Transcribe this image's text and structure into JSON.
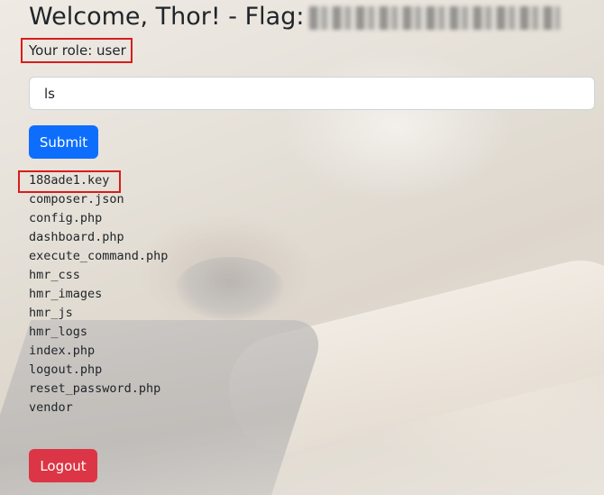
{
  "header": {
    "welcome_text": "Welcome, Thor! - Flag:",
    "flag_value": "THM{REDACTED}"
  },
  "role": {
    "text": "Your role: user"
  },
  "command_form": {
    "input_value": "ls",
    "submit_label": "Submit"
  },
  "output": {
    "files": [
      "188ade1.key",
      "composer.json",
      "config.php",
      "dashboard.php",
      "execute_command.php",
      "hmr_css",
      "hmr_images",
      "hmr_js",
      "hmr_logs",
      "index.php",
      "logout.php",
      "reset_password.php",
      "vendor"
    ]
  },
  "footer": {
    "logout_label": "Logout"
  },
  "colors": {
    "primary": "#0d6efd",
    "danger": "#dc3545",
    "highlight_border": "#d91c1c"
  }
}
